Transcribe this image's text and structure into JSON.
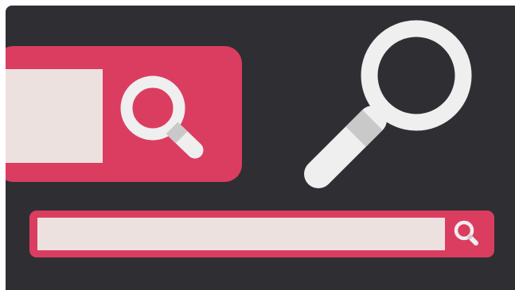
{
  "colors": {
    "background": "#2f2f33",
    "accent": "#db3d61",
    "field": "#ede1df",
    "icon_ring": "#efefef",
    "icon_neck": "#c9c9c9"
  },
  "large_search": {
    "field_value": "",
    "button_icon": "search-icon"
  },
  "standalone_icon": "search-icon",
  "small_search": {
    "field_value": "",
    "placeholder": "",
    "button_icon": "search-icon"
  }
}
